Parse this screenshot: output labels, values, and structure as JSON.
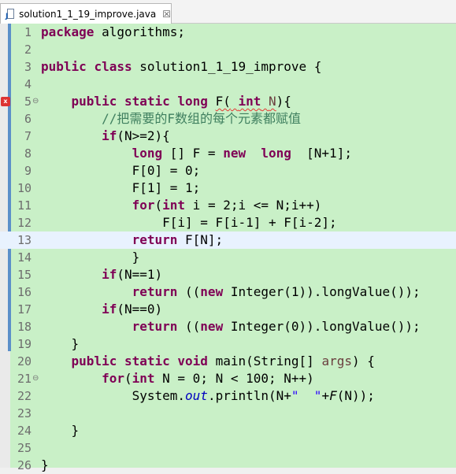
{
  "tab": {
    "label": "solution1_1_19_improve.java",
    "close": "☒"
  },
  "lines": [
    {
      "n": "1"
    },
    {
      "n": "2"
    },
    {
      "n": "3"
    },
    {
      "n": "4"
    },
    {
      "n": "5"
    },
    {
      "n": "6"
    },
    {
      "n": "7"
    },
    {
      "n": "8"
    },
    {
      "n": "9"
    },
    {
      "n": "10"
    },
    {
      "n": "11"
    },
    {
      "n": "12"
    },
    {
      "n": "13"
    },
    {
      "n": "14"
    },
    {
      "n": "15"
    },
    {
      "n": "16"
    },
    {
      "n": "17"
    },
    {
      "n": "18"
    },
    {
      "n": "19"
    },
    {
      "n": "20"
    },
    {
      "n": "21"
    },
    {
      "n": "22"
    },
    {
      "n": "23"
    },
    {
      "n": "24"
    },
    {
      "n": "25"
    },
    {
      "n": "26"
    }
  ],
  "code": {
    "l1": {
      "kw": "package",
      "rest": " algorithms;"
    },
    "l3": {
      "kw1": "public",
      "kw2": "class",
      "rest": " solution1_1_19_improve {"
    },
    "l5": {
      "kw1": "public",
      "kw2": "static",
      "kw3": "long",
      "name": "F(",
      "kw4": "int",
      "param": "N",
      "rest": "){"
    },
    "l6": {
      "comment": "//把需要的F数组的每个元素都赋值"
    },
    "l7": {
      "kw": "if",
      "rest": "(N>=2){"
    },
    "l8": {
      "kw1": "long",
      "mid": " [] F = ",
      "kw2": "new",
      "kw3": "long",
      "rest": "  [N+1];"
    },
    "l9": {
      "text": "F[0] = 0;"
    },
    "l10": {
      "text": "F[1] = 1;"
    },
    "l11": {
      "kw1": "for",
      "p1": "(",
      "kw2": "int",
      "rest": " i = 2;i <= N;i++)"
    },
    "l12": {
      "text": "F[i] = F[i-1] + F[i-2];"
    },
    "l13": {
      "kw": "return",
      "rest": " F[N];"
    },
    "l14": {
      "text": "}"
    },
    "l15": {
      "kw": "if",
      "rest": "(N==1)"
    },
    "l16": {
      "kw1": "return",
      "mid": " ((",
      "kw2": "new",
      "rest": " Integer(1)).longValue());"
    },
    "l17": {
      "kw": "if",
      "rest": "(N==0)"
    },
    "l18": {
      "kw1": "return",
      "mid": " ((",
      "kw2": "new",
      "rest": " Integer(0)).longValue());"
    },
    "l19": {
      "text": "}"
    },
    "l20": {
      "kw1": "public",
      "kw2": "static",
      "kw3": "void",
      "name": " main(String[] ",
      "param": "args",
      "rest": ") {"
    },
    "l21": {
      "kw1": "for",
      "p1": "(",
      "kw2": "int",
      "rest": " N = 0; N < 100; N++)"
    },
    "l22": {
      "pre": "System.",
      "field": "out",
      "mid": ".println(N+",
      "str": "\"  \"",
      "plus": "+",
      "call": "F",
      "rest": "(N));"
    },
    "l24": {
      "text": "}"
    },
    "l26": {
      "text": "}"
    }
  },
  "colors": {
    "background": "#c9f0c7",
    "keyword": "#7f0055",
    "comment": "#3f7f5f",
    "current_line": "#e8f2fe",
    "change_bar": "#5b8fc9"
  }
}
